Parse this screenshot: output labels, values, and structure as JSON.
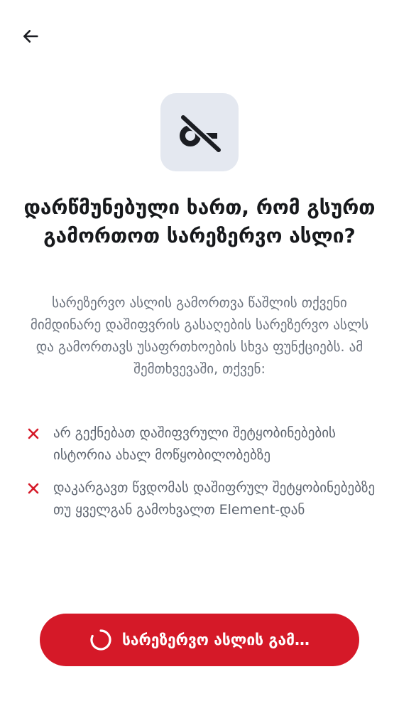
{
  "header": {
    "back_icon": "arrow-left-icon"
  },
  "hero": {
    "icon": "key-off-icon",
    "icon_bg": "#e4e8f0"
  },
  "title": "დარწმუნებული ხართ, რომ გსურთ გამორთოთ სარეზერვო ასლი?",
  "description": "სარეზერვო ასლის გამორთვა წაშლის თქვენი მიმდინარე დაშიფვრის გასაღების სარეზერვო ასლს და გამორთავს უსაფრთხოების სხვა ფუნქციებს. ამ შემთხვევაში, თქვენ:",
  "consequences": [
    {
      "icon": "close-icon",
      "text": "არ გექნებათ დაშიფვრული შეტყობინებების ისტორია ახალ მოწყობილობებზე"
    },
    {
      "icon": "close-icon",
      "text": "დაკარგავთ წვდომას დაშიფრულ შეტყობინებებზე თუ ყველგან გამოხვალთ Element-დან"
    }
  ],
  "button": {
    "label": "სარეზერვო ასლის გამ…",
    "state": "loading",
    "spinner_icon": "spinner-icon"
  },
  "colors": {
    "accent": "#d51928",
    "critical_icon": "#d51928",
    "text_primary": "#17191c",
    "text_secondary": "#6c737e"
  }
}
